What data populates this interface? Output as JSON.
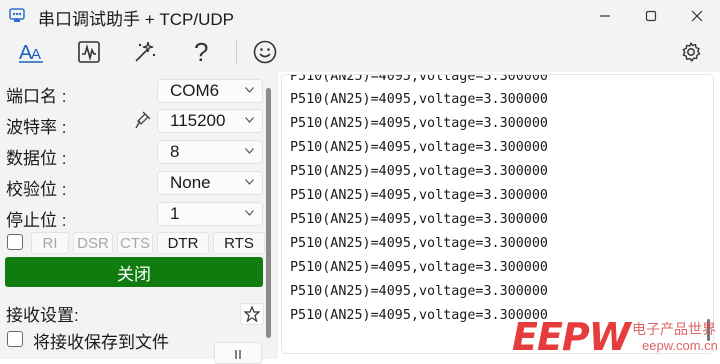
{
  "window": {
    "title": "串口调试助手 + TCP/UDP"
  },
  "icons": {
    "app": "serial-port-app-icon",
    "font": "font-size-icon",
    "chart": "waveform-chart-icon",
    "magic": "magic-wand-icon",
    "help": "question-mark-icon",
    "smile": "smiley-face-icon",
    "settings": "gear-icon"
  },
  "serial": {
    "port": {
      "label": "端口名 :",
      "value": "COM6"
    },
    "baud": {
      "label": "波特率 :",
      "value": "115200"
    },
    "databits": {
      "label": "数据位 :",
      "value": "8"
    },
    "parity": {
      "label": "校验位 :",
      "value": "None"
    },
    "stopbits": {
      "label": "停止位 :",
      "value": "1"
    }
  },
  "signals": {
    "ri": "RI",
    "dsr": "DSR",
    "cts": "CTS",
    "dtr": "DTR",
    "rts": "RTS"
  },
  "close_button": "关闭",
  "receive": {
    "label": "接收设置:",
    "save_to_file": "将接收保存到文件"
  },
  "terminal": {
    "partial_top": "P510(AN25)=4095,voltage=3.300000",
    "lines": [
      "P510(AN25)=4095,voltage=3.300000",
      "P510(AN25)=4095,voltage=3.300000",
      "P510(AN25)=4095,voltage=3.300000",
      "P510(AN25)=4095,voltage=3.300000",
      "P510(AN25)=4095,voltage=3.300000",
      "P510(AN25)=4095,voltage=3.300000",
      "P510(AN25)=4095,voltage=3.300000",
      "P510(AN25)=4095,voltage=3.300000",
      "P510(AN25)=4095,voltage=3.300000",
      "P510(AN25)=4095,voltage=3.300000"
    ]
  },
  "watermark": {
    "brand": "EEPW",
    "cn": "电子产品世界",
    "url": "eepw.com.cn"
  },
  "colors": {
    "accent_green": "#107c10",
    "brand_blue": "#1f5fbf",
    "watermark_red": "#e53d3d"
  }
}
